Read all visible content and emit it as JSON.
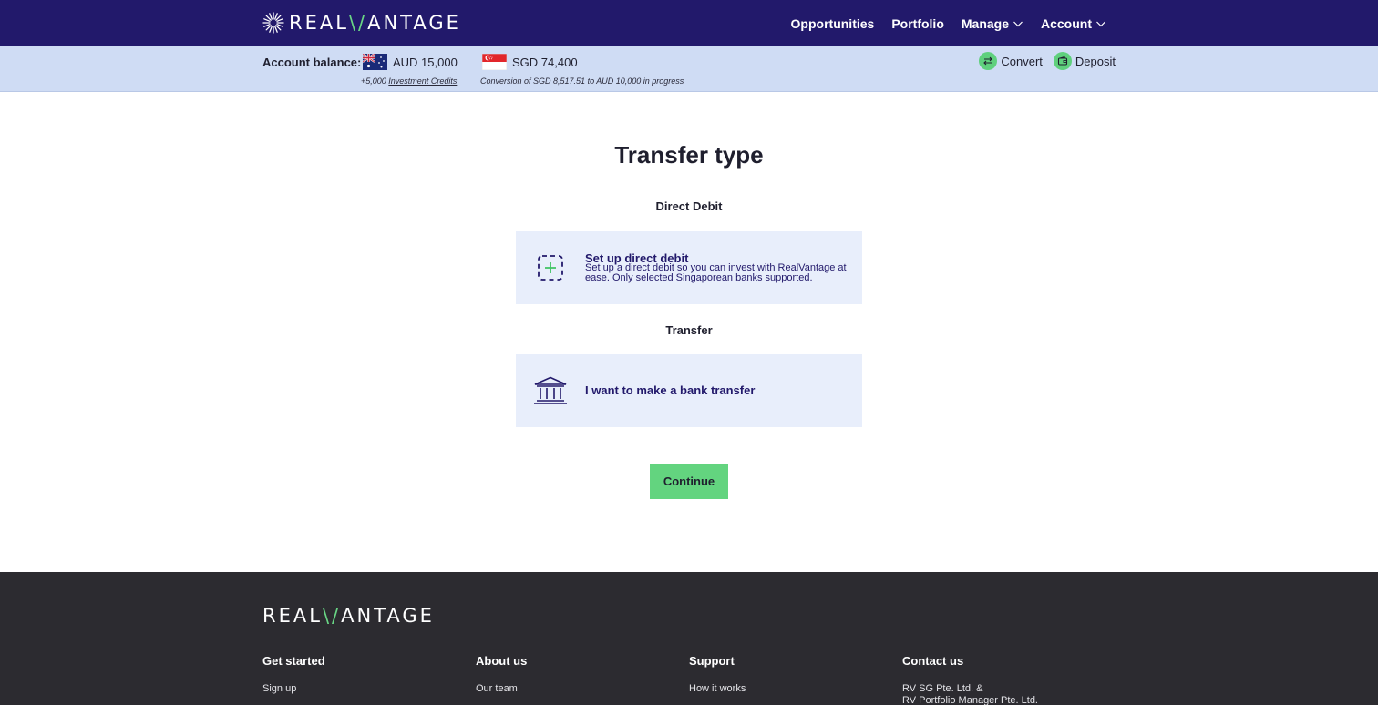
{
  "brand": {
    "logo_pre": "REAL",
    "logo_v": "\\/",
    "logo_post": "ANTAGE"
  },
  "nav": {
    "items": [
      {
        "label": "Opportunities"
      },
      {
        "label": "Portfolio"
      },
      {
        "label": "Manage"
      },
      {
        "label": "Account"
      }
    ]
  },
  "balance": {
    "label": "Account balance:",
    "aud": "AUD 15,000",
    "sgd": "SGD 74,400",
    "credits_prefix": "+5,000",
    "credits_link": "Investment Credits",
    "conversion_note": "Conversion of SGD 8,517.51 to AUD 10,000 in progress",
    "convert_label": "Convert",
    "deposit_label": "Deposit"
  },
  "main": {
    "title": "Transfer type",
    "direct_debit": {
      "section": "Direct Debit",
      "title": "Set up direct debit",
      "desc": "Set up a direct debit so you can invest with RealVantage at ease. Only selected Singaporean banks supported."
    },
    "transfer": {
      "section": "Transfer",
      "title": "I want to make a bank transfer"
    },
    "continue_label": "Continue"
  },
  "footer": {
    "columns": [
      {
        "heading": "Get started",
        "links": [
          "Sign up"
        ]
      },
      {
        "heading": "About us",
        "links": [
          "Our team"
        ]
      },
      {
        "heading": "Support",
        "links": [
          "How it works"
        ]
      },
      {
        "heading": "Contact us",
        "links": [
          "RV SG Pte. Ltd. &",
          "RV Portfolio Manager Pte. Ltd."
        ]
      }
    ]
  },
  "colors": {
    "nav_bg": "#22196b",
    "accent": "#63d47f",
    "balance_bg": "#cfdcf4",
    "card_bg": "#e8eefb",
    "footer_bg": "#2c2b30"
  }
}
